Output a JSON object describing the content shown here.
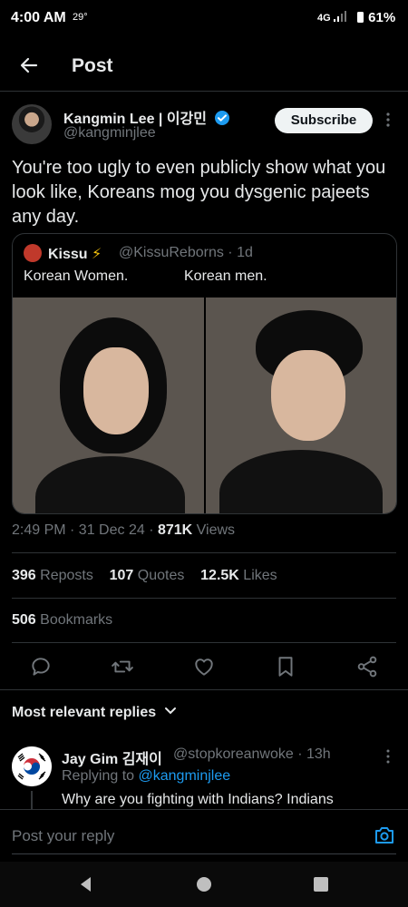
{
  "status": {
    "time": "4:00 AM",
    "temp": "29°",
    "network": "4G",
    "battery": "61%"
  },
  "header": {
    "title": "Post"
  },
  "author": {
    "name": "Kangmin Lee | 이강민",
    "handle": "@kangminjlee",
    "subscribe_label": "Subscribe"
  },
  "tweet": {
    "text": "You're too ugly to even publicly show what you look like, Koreans mog you dysgenic pajeets any day."
  },
  "quote": {
    "name": "Kissu",
    "bolt": "⚡",
    "meta": "@KissuReborns · 1d",
    "text_left": "Korean Women.",
    "text_right": "Korean men."
  },
  "meta": {
    "time": "2:49 PM · 31 Dec 24 · ",
    "views_count": "871K",
    "views_label": " Views"
  },
  "stats": {
    "reposts_count": "396",
    "reposts_label": " Reposts",
    "quotes_count": "107",
    "quotes_label": " Quotes",
    "likes_count": "12.5K",
    "likes_label": " Likes",
    "bookmarks_count": "506",
    "bookmarks_label": " Bookmarks"
  },
  "replies_header": "Most relevant replies",
  "reply": {
    "name": "Jay Gim 김재이",
    "meta": "@stopkoreanwoke · 13h",
    "replying_prefix": "Replying to ",
    "replying_handle": "@kangminjlee",
    "text": "Why are you fighting with Indians? Indians"
  },
  "compose": {
    "placeholder": "Post your reply"
  },
  "colors": {
    "accent": "#1d9bf0",
    "background": "#000000",
    "text": "#e7e9ea",
    "muted": "#71767b"
  },
  "icons": [
    "back-arrow-icon",
    "verified-badge-icon",
    "more-icon",
    "reply-icon",
    "repost-icon",
    "like-icon",
    "bookmark-icon",
    "share-icon",
    "chevron-down-icon",
    "camera-icon",
    "nav-back-icon",
    "nav-home-icon",
    "nav-recents-icon"
  ]
}
